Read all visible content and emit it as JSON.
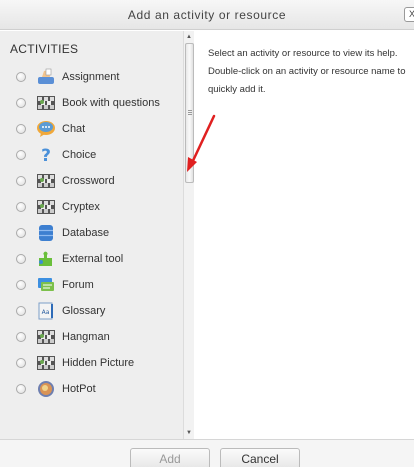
{
  "dialog": {
    "title": "Add an activity or resource",
    "close_glyph": "X"
  },
  "activities": {
    "heading": "ACTIVITIES",
    "items": [
      {
        "label": "Assignment",
        "icon": "assignment-icon"
      },
      {
        "label": "Book with questions",
        "icon": "game-board-icon"
      },
      {
        "label": "Chat",
        "icon": "chat-icon"
      },
      {
        "label": "Choice",
        "icon": "question-mark-icon"
      },
      {
        "label": "Crossword",
        "icon": "game-board-icon"
      },
      {
        "label": "Cryptex",
        "icon": "game-board-icon"
      },
      {
        "label": "Database",
        "icon": "database-icon"
      },
      {
        "label": "External tool",
        "icon": "puzzle-icon"
      },
      {
        "label": "Forum",
        "icon": "forum-icon"
      },
      {
        "label": "Glossary",
        "icon": "glossary-icon"
      },
      {
        "label": "Hangman",
        "icon": "game-board-icon"
      },
      {
        "label": "Hidden Picture",
        "icon": "game-board-icon"
      },
      {
        "label": "HotPot",
        "icon": "hotpot-icon"
      }
    ]
  },
  "help": {
    "text": "Select an activity or resource to view its help. Double-click on an activity or resource name to quickly add it."
  },
  "footer": {
    "add_label": "Add",
    "cancel_label": "Cancel"
  },
  "colors": {
    "annotation_arrow": "#e02020"
  }
}
